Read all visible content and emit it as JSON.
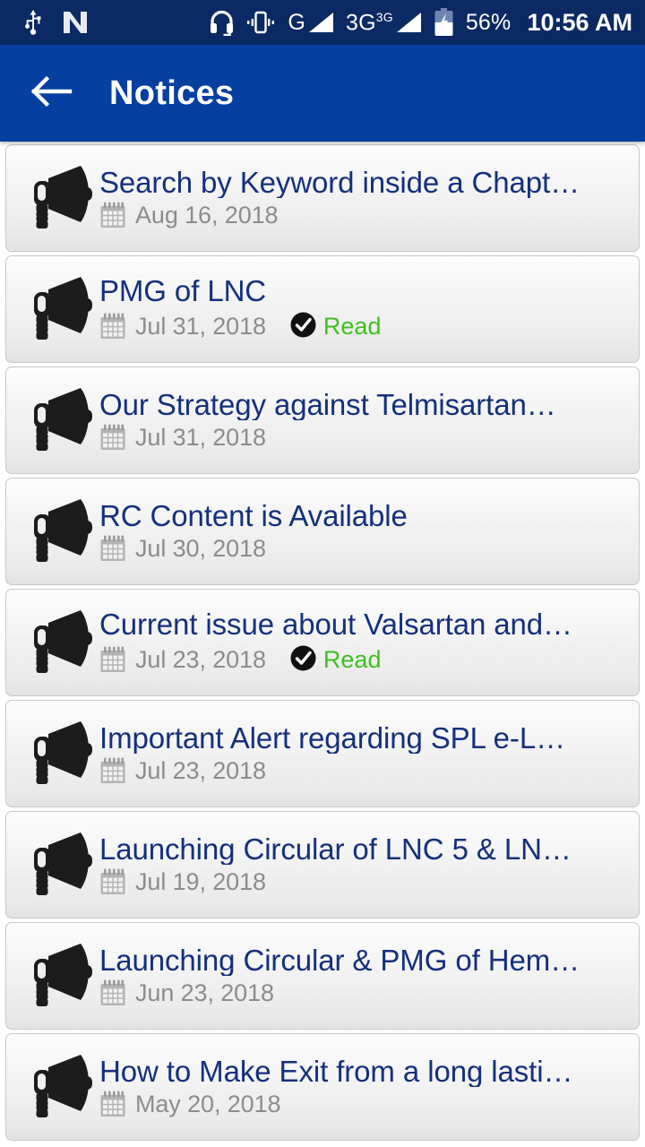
{
  "status_bar": {
    "background_color": "#0b2a63",
    "left_icons": [
      {
        "name": "usb-icon",
        "label": "USB"
      },
      {
        "name": "nfc-icon",
        "label": "N"
      }
    ],
    "right_icons": [
      {
        "name": "headset-icon",
        "label": "Headset"
      },
      {
        "name": "vibrate-icon",
        "label": "Vibrate"
      }
    ],
    "network_1": {
      "label": "G",
      "superscript": ""
    },
    "network_2": {
      "label": "3G",
      "superscript": "3G"
    },
    "battery": {
      "icon": "battery-charging-icon",
      "percent": "56%"
    },
    "clock": "10:56 AM"
  },
  "app_bar": {
    "background_color": "#053fa0",
    "back_icon": "arrow-left-icon",
    "title": "Notices"
  },
  "list": {
    "item_icon": "megaphone-icon",
    "date_icon": "calendar-icon",
    "read_icon": "check-circle-icon",
    "read_label": "Read",
    "title_color": "#14307c",
    "date_color": "#8c8c8c",
    "read_color": "#3fbf20",
    "items": [
      {
        "title": "Search by Keyword inside a Chapt…",
        "date": "Aug 16, 2018",
        "read": false
      },
      {
        "title": "PMG of LNC",
        "date": "Jul 31, 2018",
        "read": true
      },
      {
        "title": "Our Strategy against Telmisartan…",
        "date": "Jul 31, 2018",
        "read": false
      },
      {
        "title": "RC Content is Available",
        "date": "Jul 30, 2018",
        "read": false
      },
      {
        "title": "Current issue about Valsartan and…",
        "date": "Jul 23, 2018",
        "read": true
      },
      {
        "title": "Important Alert regarding SPL e-L…",
        "date": "Jul 23, 2018",
        "read": false
      },
      {
        "title": "Launching Circular of LNC 5 & LN…",
        "date": "Jul 19, 2018",
        "read": false
      },
      {
        "title": "Launching Circular & PMG of Hem…",
        "date": "Jun 23, 2018",
        "read": false
      },
      {
        "title": "How to Make Exit from a long lasti…",
        "date": "May 20, 2018",
        "read": false
      }
    ]
  }
}
